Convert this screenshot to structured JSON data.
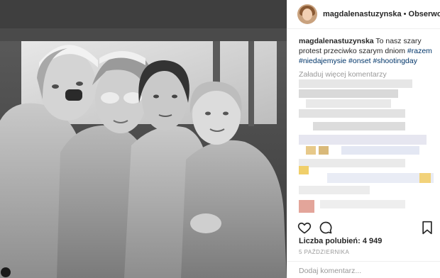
{
  "header": {
    "username": "magdalenastuzynska",
    "separator": "•",
    "follow_label": "Obserwow"
  },
  "caption": {
    "username": "magdalenastuzynska",
    "text_line1": "To nasz szary",
    "text_line2": "protest przeciwko szarym dniom",
    "tag1": "#razem",
    "tag2": "#niedajemysie",
    "tag3": "#onset",
    "tag4": "#shootingday"
  },
  "comments": {
    "load_more": "Załaduj więcej komentarzy"
  },
  "actions": {
    "like_icon": "heart-icon",
    "comment_icon": "comment-bubble-icon",
    "save_icon": "bookmark-icon"
  },
  "likes_text": "Liczba polubień: 4 949",
  "date_text": "5 PAŹDZIERNIKA",
  "add_comment_placeholder": "Dodaj komentarz...",
  "colors": {
    "text": "#262626",
    "hashtag": "#003569",
    "muted": "#999999",
    "border": "#efefef"
  }
}
